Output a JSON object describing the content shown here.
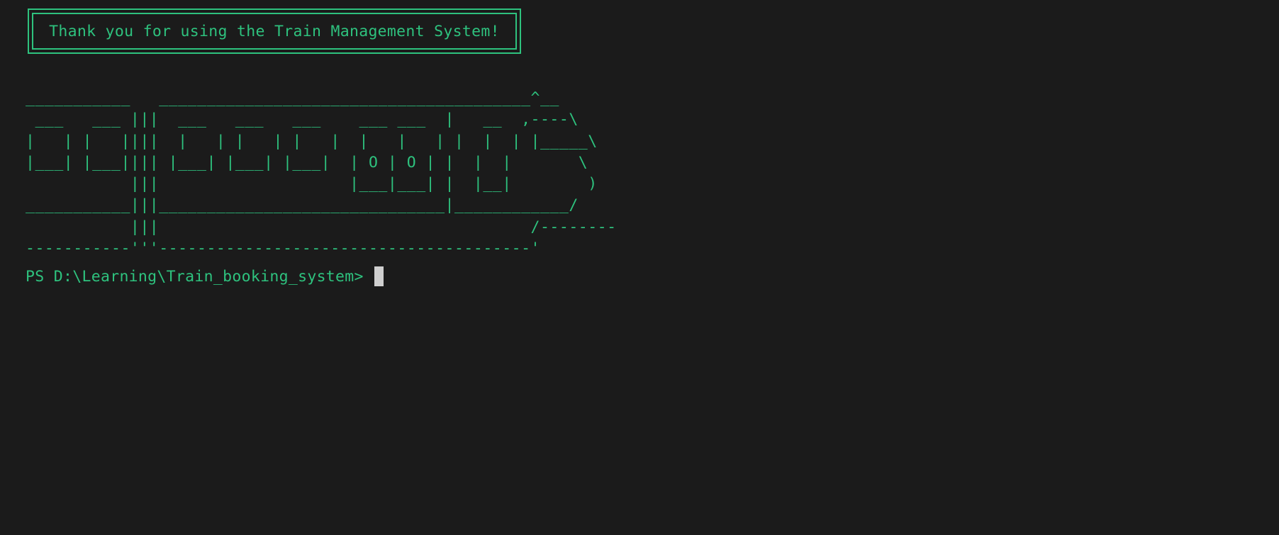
{
  "banner": {
    "message": "Thank you for using the Train Management System!"
  },
  "ascii_art": {
    "lines": [
      "___________   _______________________________________^__",
      " ___   ___ |||  ___   ___   ___    ___ ___  |   __  ,----\\",
      "|   | |   ||||  |   | |   | |   |  |   |   | |  |  | |_____\\",
      "|___| |___|||| |___| |___| |___|  | O | O | |  |  |       \\",
      "           |||                    |___|___| |  |__|        )",
      "___________|||______________________________|____________/",
      "           |||                                       /--------",
      "-----------'''---------------------------------------'"
    ]
  },
  "prompt": {
    "text": "PS D:\\Learning\\Train_booking_system> "
  },
  "colors": {
    "background": "#1b1b1b",
    "text": "#2ec27e",
    "cursor": "#cfcfcf"
  }
}
